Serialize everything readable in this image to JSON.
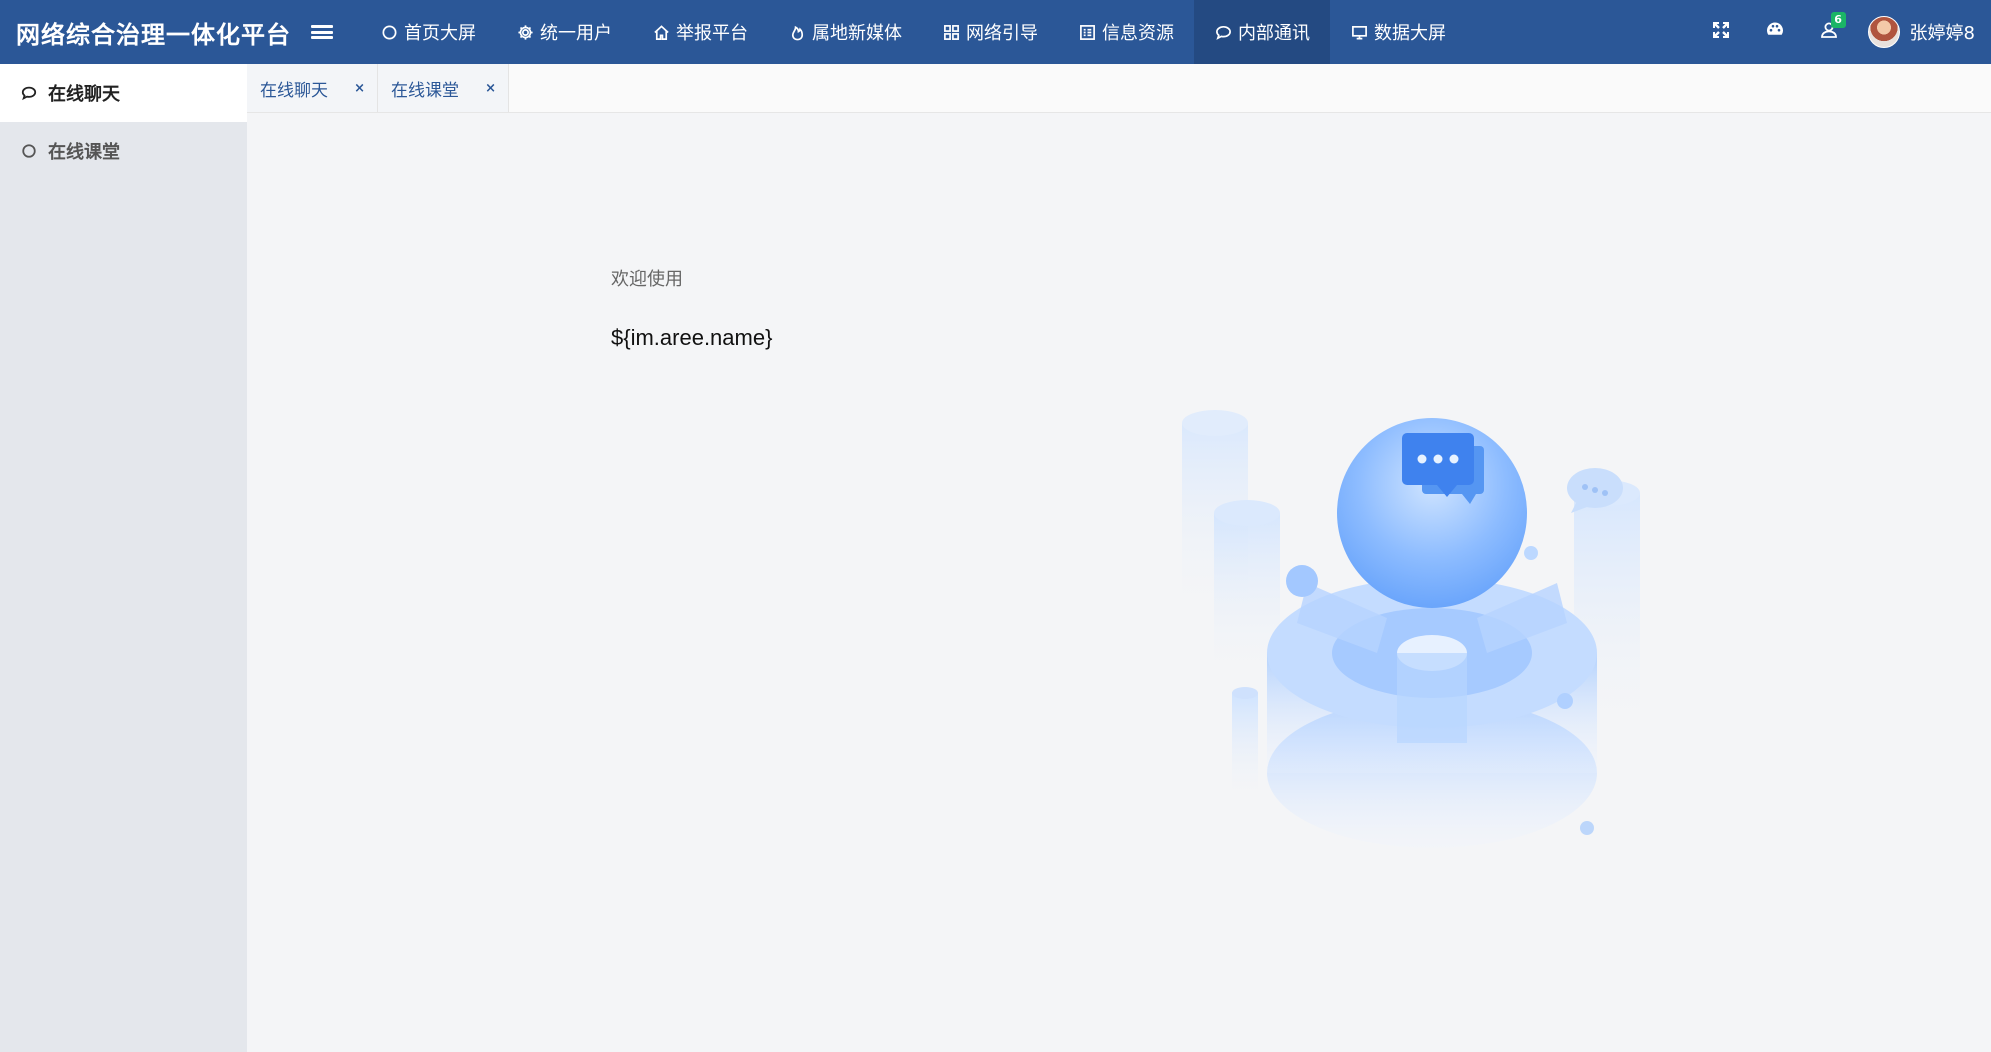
{
  "app": {
    "title": "网络综合治理一体化平台"
  },
  "nav": [
    {
      "label": "首页大屏",
      "icon": "circle-icon"
    },
    {
      "label": "统一用户",
      "icon": "gear-icon"
    },
    {
      "label": "举报平台",
      "icon": "home-icon"
    },
    {
      "label": "属地新媒体",
      "icon": "flame-icon"
    },
    {
      "label": "网络引导",
      "icon": "grid-icon"
    },
    {
      "label": "信息资源",
      "icon": "list-box-icon"
    },
    {
      "label": "内部通讯",
      "icon": "chat-bubble-icon",
      "active": true
    },
    {
      "label": "数据大屏",
      "icon": "monitor-icon"
    }
  ],
  "toolbar": {
    "notification_count": "6",
    "username": "张婷婷8"
  },
  "sidebar": {
    "items": [
      {
        "label": "在线聊天",
        "icon": "chat-bubble-icon",
        "active": true
      },
      {
        "label": "在线课堂",
        "icon": "circle-icon",
        "active": false
      }
    ]
  },
  "tabs": [
    {
      "label": "在线聊天",
      "close": "×"
    },
    {
      "label": "在线课堂",
      "close": "×"
    }
  ],
  "main": {
    "welcome": "欢迎使用",
    "name": "${im.aree.name}"
  },
  "colors": {
    "header": "#2b5797",
    "header_active": "#244a82",
    "sidebar": "#e4e7ec",
    "badge": "#1bb566"
  }
}
